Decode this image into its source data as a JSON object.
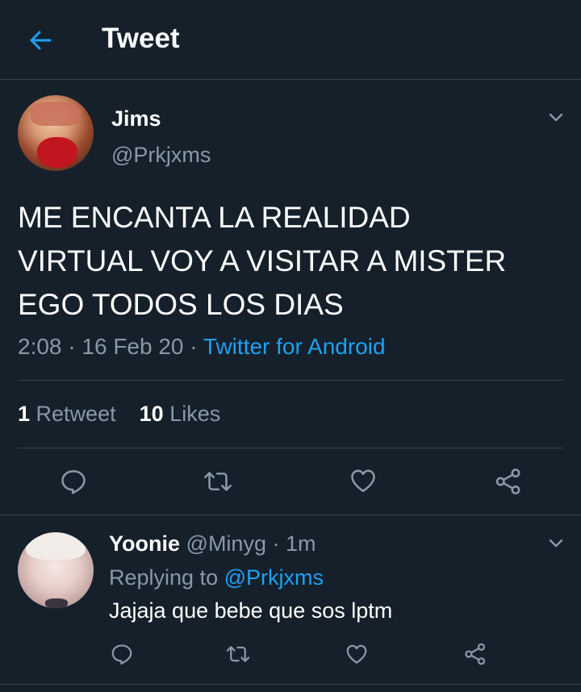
{
  "header": {
    "title": "Tweet"
  },
  "tweet": {
    "display_name": "Jims",
    "handle": "@Prkjxms",
    "text_lines": [
      "ME ENCANTA LA REALIDAD",
      "VIRTUAL VOY A VISITAR A MISTER",
      "EGO TODOS LOS DIAS"
    ],
    "time": "2:08",
    "separator": "·",
    "date": "16 Feb 20",
    "source": "Twitter for Android",
    "retweet_count": "1",
    "retweet_label": "Retweet",
    "likes_count": "10",
    "likes_label": "Likes"
  },
  "reply": {
    "display_name": "Yoonie",
    "handle": "@Minyg",
    "separator": "·",
    "age": "1m",
    "replying_to_label": "Replying to",
    "replying_to_handle": "@Prkjxms",
    "text": "Jajaja que bebe que sos lptm"
  },
  "icons": {
    "back": "arrow-left-icon",
    "more": "chevron-down-icon",
    "reply": "reply-icon",
    "retweet": "retweet-icon",
    "like": "heart-icon",
    "share": "share-icon"
  },
  "colors": {
    "background": "#15202b",
    "accent": "#1da1f2",
    "muted_text": "#8899a6",
    "divider": "#38444d"
  }
}
